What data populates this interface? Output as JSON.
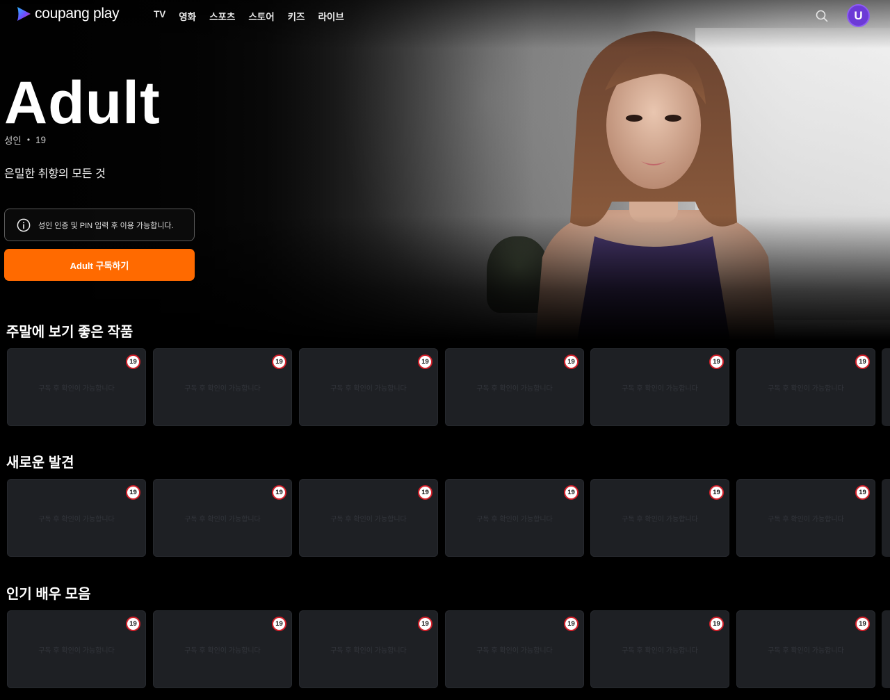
{
  "header": {
    "logo_text": "coupang play",
    "nav": [
      "TV",
      "영화",
      "스포츠",
      "스토어",
      "키즈",
      "라이브"
    ],
    "avatar_initial": "U"
  },
  "hero": {
    "title": "Adult",
    "meta_category": "성인",
    "meta_separator": "•",
    "meta_rating": "19",
    "description": "은밀한 취향의 모든 것",
    "notice": "성인 인증 및 PIN 입력 후 이용 가능합니다.",
    "subscribe_label": "Adult 구독하기"
  },
  "rows": [
    {
      "title": "주말에 보기 좋은 작품",
      "cards": [
        {
          "badge": "19",
          "placeholder": "구독 후 확인이 가능합니다"
        },
        {
          "badge": "19",
          "placeholder": "구독 후 확인이 가능합니다"
        },
        {
          "badge": "19",
          "placeholder": "구독 후 확인이 가능합니다"
        },
        {
          "badge": "19",
          "placeholder": "구독 후 확인이 가능합니다"
        },
        {
          "badge": "19",
          "placeholder": "구독 후 확인이 가능합니다"
        },
        {
          "badge": "19",
          "placeholder": "구독 후 확인이 가능합니다"
        }
      ]
    },
    {
      "title": "새로운 발견",
      "cards": [
        {
          "badge": "19",
          "placeholder": "구독 후 확인이 가능합니다"
        },
        {
          "badge": "19",
          "placeholder": "구독 후 확인이 가능합니다"
        },
        {
          "badge": "19",
          "placeholder": "구독 후 확인이 가능합니다"
        },
        {
          "badge": "19",
          "placeholder": "구독 후 확인이 가능합니다"
        },
        {
          "badge": "19",
          "placeholder": "구독 후 확인이 가능합니다"
        },
        {
          "badge": "19",
          "placeholder": "구독 후 확인이 가능합니다"
        }
      ]
    },
    {
      "title": "인기 배우 모음",
      "cards": [
        {
          "badge": "19",
          "placeholder": "구독 후 확인이 가능합니다"
        },
        {
          "badge": "19",
          "placeholder": "구독 후 확인이 가능합니다"
        },
        {
          "badge": "19",
          "placeholder": "구독 후 확인이 가능합니다"
        },
        {
          "badge": "19",
          "placeholder": "구독 후 확인이 가능합니다"
        },
        {
          "badge": "19",
          "placeholder": "구독 후 확인이 가능합니다"
        },
        {
          "badge": "19",
          "placeholder": "구독 후 확인이 가능합니다"
        }
      ]
    }
  ],
  "colors": {
    "accent": "#ff6a00",
    "avatar": "#6c3ad6",
    "badge_ring": "#d5202a",
    "card": "#1e2024"
  },
  "icons": {
    "logo": "play-triangle-icon",
    "search": "search-icon",
    "notice": "info-icon"
  }
}
